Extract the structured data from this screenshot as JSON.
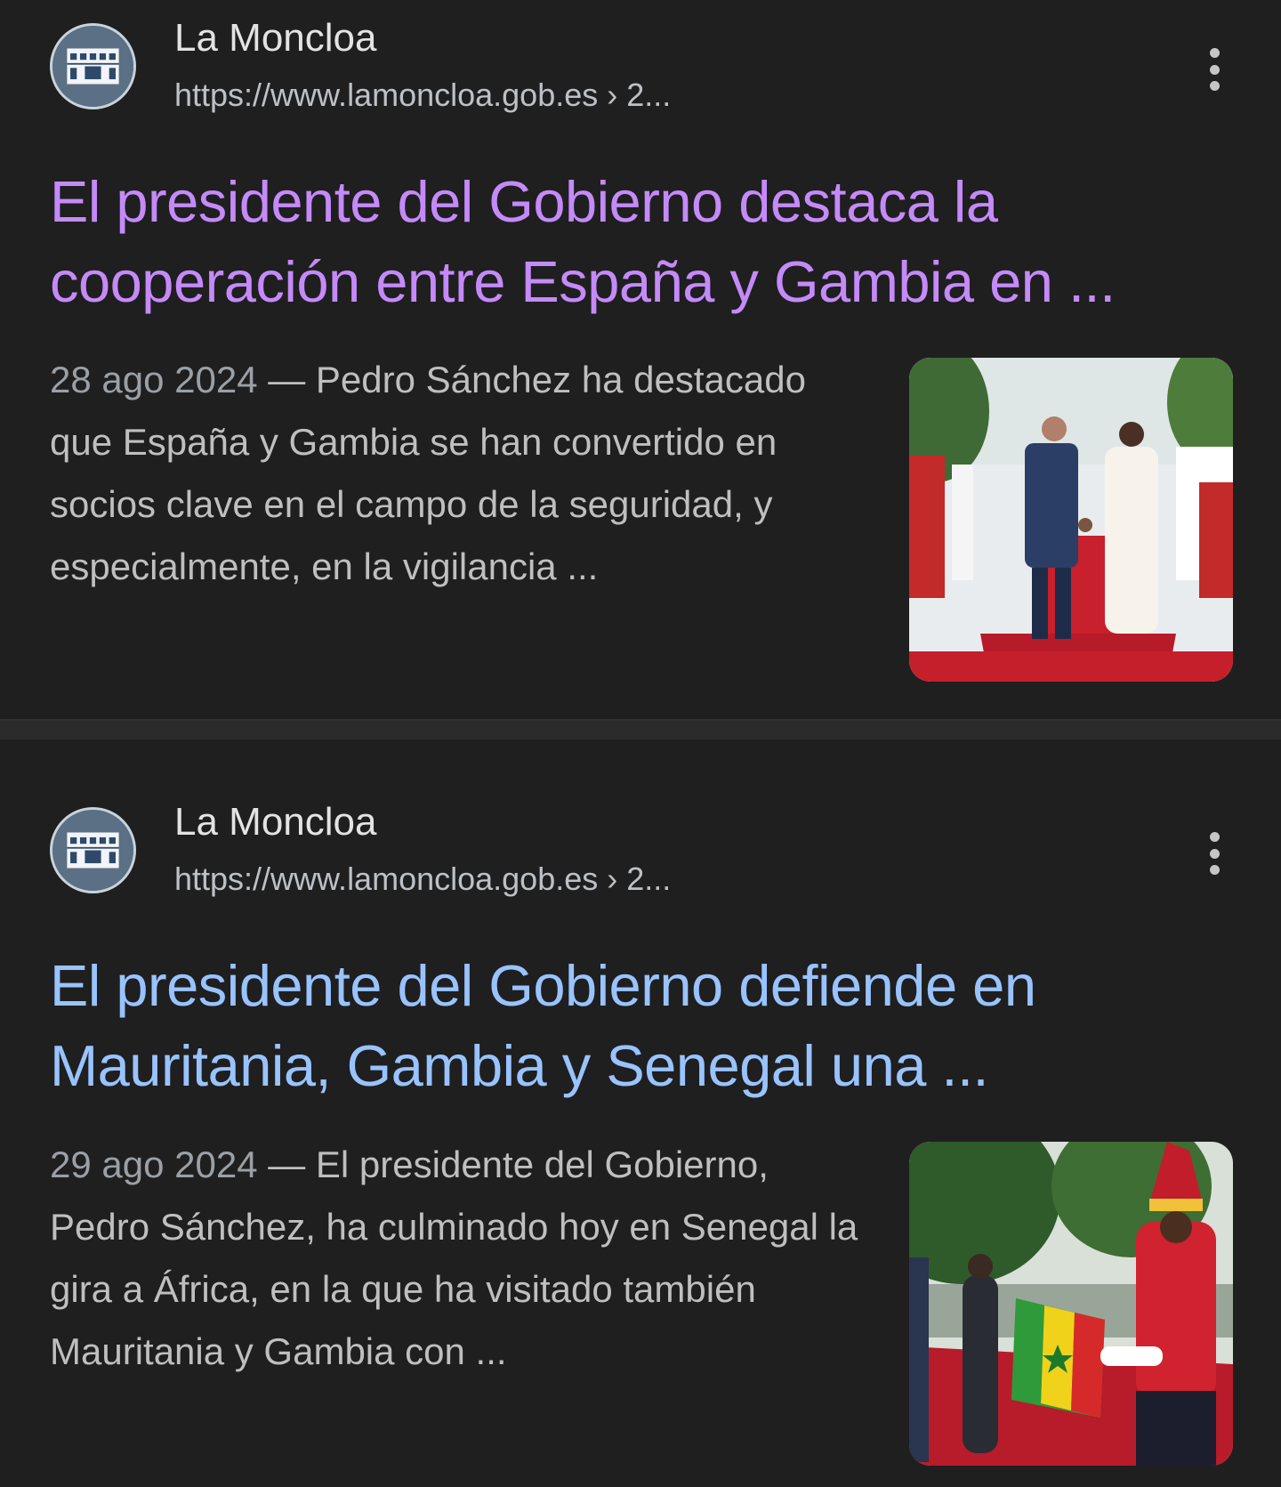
{
  "results": [
    {
      "site_name": "La Moncloa",
      "url": "https://www.lamoncloa.gob.es",
      "url_suffix": " › 2...",
      "title_line1": "El presidente del Gobierno destaca la",
      "title_line2": "cooperación entre España y Gambia en ...",
      "date": "28 ago 2024",
      "separator": " — ",
      "snippet": "Pedro Sánchez ha destacado que España y Gambia se han convertido en socios clave en el campo de la seguridad, y especialmente, en la vigilancia ...",
      "title_color": "#c58af9",
      "thumbnail_icon": "handshake-photo"
    },
    {
      "site_name": "La Moncloa",
      "url": "https://www.lamoncloa.gob.es",
      "url_suffix": " › 2...",
      "title_line1": "El presidente del Gobierno defiende en",
      "title_line2": "Mauritania, Gambia y Senegal una ...",
      "date": "29 ago 2024",
      "separator": " — ",
      "snippet": "El presidente del Gobierno, Pedro Sánchez, ha culminado hoy en Senegal la gira a África, en la que ha visitado también Mauritania y Gambia con ...",
      "title_color": "#99c3ff",
      "thumbnail_icon": "flag-ceremony-photo"
    }
  ],
  "colors": {
    "background": "#1f1f1f",
    "visited_link": "#c58af9",
    "link": "#99c3ff",
    "snippet_text": "#bfbfbf"
  }
}
